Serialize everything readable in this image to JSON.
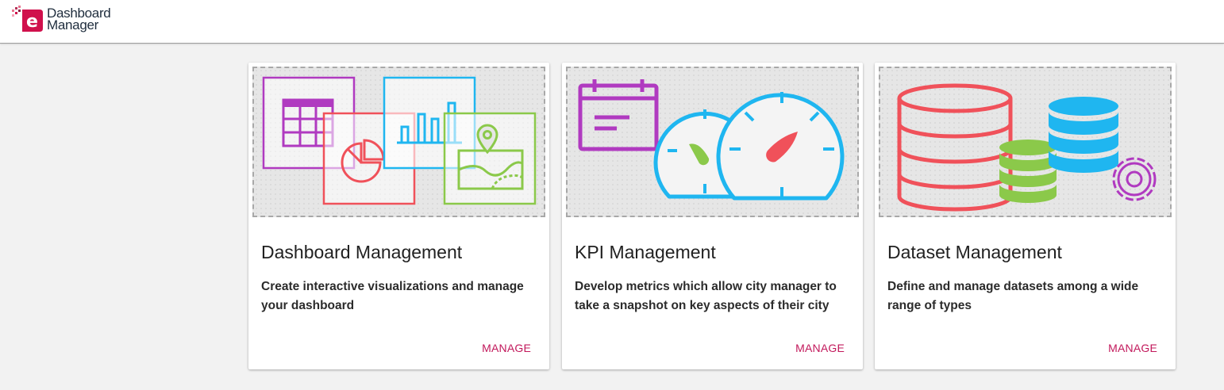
{
  "header": {
    "logo_line1": "Dashboard",
    "logo_line2": "Manager"
  },
  "cards": [
    {
      "title": "Dashboard Management",
      "description": "Create interactive visualizations and manage your dashboard",
      "action": "MANAGE",
      "illustration": "dashboard-collage-icon"
    },
    {
      "title": "KPI Management",
      "description": "Develop metrics which allow city manager to take a snapshot on key aspects of their city",
      "action": "MANAGE",
      "illustration": "gauges-calendar-icon"
    },
    {
      "title": "Dataset Management",
      "description": "Define and manage datasets among a wide range of types",
      "action": "MANAGE",
      "illustration": "database-stack-icon"
    }
  ],
  "colors": {
    "brand": "#d0104c",
    "action": "#c2185b",
    "purple": "#b03ac0",
    "red": "#f0515a",
    "blue": "#1fb6f0",
    "green": "#8bc94a"
  }
}
